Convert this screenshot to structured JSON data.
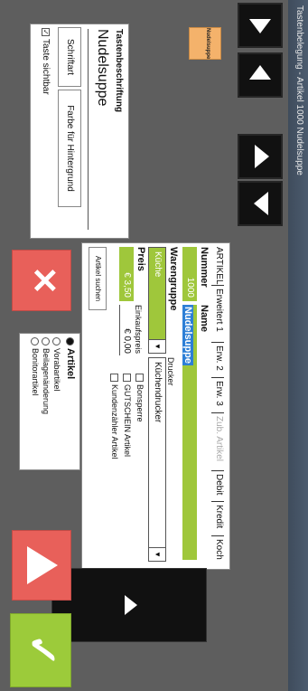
{
  "window": {
    "title": "Tastenbelegung - Artikel 1000 Nudelsuppe"
  },
  "tabs": [
    {
      "label": "ARTIKEL",
      "enabled": true
    },
    {
      "label": "Erweitert 1",
      "enabled": true
    },
    {
      "label": "Erw. 2",
      "enabled": true
    },
    {
      "label": "Erw. 3",
      "enabled": true
    },
    {
      "label": "Zub. Artikel",
      "enabled": false
    },
    {
      "label": "Debit",
      "enabled": true
    },
    {
      "label": "Kredit",
      "enabled": true
    },
    {
      "label": "Koch",
      "enabled": true
    }
  ],
  "artikel": {
    "nummer_label": "Nummer",
    "nummer_value": "1000",
    "name_label": "Name",
    "name_value": "Nudelsuppe",
    "warengruppe_label": "Warengruppe",
    "warengruppe_value": "Küche",
    "drucker_label": "Drucker",
    "drucker_value": "Küchendrucker",
    "preis_label": "Preis",
    "preis_value": "€ 3,50",
    "einkaufspreis_label": "Einkaufspreis",
    "einkaufspreis_value": "€ 0,00",
    "search_button": "Artikel suchen",
    "bonsperre_label": "Bonsperre",
    "gutschein_label": "GUTSCHEIN Artikel",
    "kundenzaehler_label": "Kundenzähler Artikel"
  },
  "preview": {
    "key_label": "Nudelsuppe"
  },
  "beschriftung": {
    "heading": "Tastenbeschriftung",
    "text": "Nudelsuppe",
    "schriftart_button": "Schriftart",
    "farbe_button": "Farbe für Hintergrund",
    "sichtbar_label": "Taste sichtbar"
  },
  "typ": {
    "options": [
      "Artikel",
      "Vorabartikel",
      "Beilagenänderung",
      "Bonitorartikel"
    ],
    "selected": "Artikel"
  },
  "colors": {
    "green": "#9fc73b",
    "red": "#e8605a",
    "orange": "#f4b26b",
    "confirm": "#9ccb3a",
    "highlight": "#2d7fd6"
  }
}
